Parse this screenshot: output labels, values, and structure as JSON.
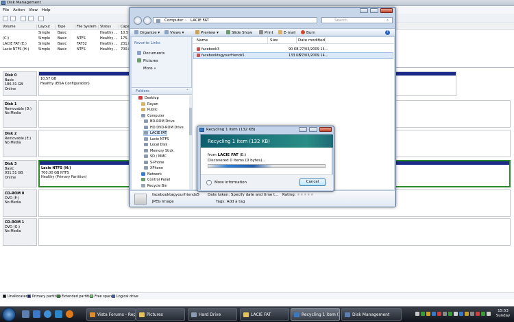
{
  "disk_mgmt": {
    "title": "Disk Management",
    "menu": [
      "File",
      "Action",
      "View",
      "Help"
    ],
    "columns": [
      "Volume",
      "Layout",
      "Type",
      "File System",
      "Status",
      "Capa"
    ],
    "volumes": [
      {
        "name": "",
        "layout": "Simple",
        "type": "Basic",
        "fs": "",
        "status": "Healthy ...",
        "cap": "10.5"
      },
      {
        "name": "(C:)",
        "layout": "Simple",
        "type": "Basic",
        "fs": "NTFS",
        "status": "Healthy ...",
        "cap": "175."
      },
      {
        "name": "LACIE FAT (E:)",
        "layout": "Simple",
        "type": "Basic",
        "fs": "FAT32",
        "status": "Healthy ...",
        "cap": "231.8"
      },
      {
        "name": "Lacie NTFS (H:)",
        "layout": "Simple",
        "type": "Basic",
        "fs": "NTFS",
        "status": "Healthy ...",
        "cap": "700.8"
      }
    ],
    "disks": [
      {
        "name": "Disk 0",
        "l1": "Basic",
        "l2": "186.31 GB",
        "l3": "Online",
        "p1": "",
        "p2": "10.57 GB",
        "p3": "Healthy (EISA Configuration)"
      },
      {
        "name": "Disk 1",
        "l1": "Removable (D:)",
        "l2": "",
        "l3": "No Media",
        "p1": "",
        "p2": "",
        "p3": ""
      },
      {
        "name": "Disk 2",
        "l1": "Removable (E:)",
        "l2": "",
        "l3": "No Media",
        "p1": "",
        "p2": "",
        "p3": ""
      },
      {
        "name": "Disk 3",
        "l1": "Basic",
        "l2": "931.51 GB",
        "l3": "Online",
        "p1": "Lacie NTFS  (H:)",
        "p2": "700.00 GB NTFS",
        "p3": "Healthy (Primary Partition)"
      },
      {
        "name": "CD-ROM 0",
        "l1": "DVD (F:)",
        "l2": "",
        "l3": "No Media",
        "p1": "",
        "p2": "",
        "p3": ""
      },
      {
        "name": "CD-ROM 1",
        "l1": "DVD (G:)",
        "l2": "",
        "l3": "No Media",
        "p1": "",
        "p2": "",
        "p3": ""
      }
    ],
    "legend": [
      {
        "label": "Unallocated",
        "color": "#000000"
      },
      {
        "label": "Primary partition",
        "color": "#1a2a86"
      },
      {
        "label": "Extended partition",
        "color": "#2c8a2c"
      },
      {
        "label": "Free space",
        "color": "#6ad06a"
      },
      {
        "label": "Logical drive",
        "color": "#3a58c8"
      }
    ]
  },
  "explorer": {
    "breadcrumb": [
      "Computer",
      "LACIE FAT"
    ],
    "search_placeholder": "Search",
    "commands": [
      "Organize",
      "Views",
      "Slide Show",
      "Print",
      "E-mail",
      "Burn"
    ],
    "favorites_head": "Favorite Links",
    "favorites": [
      "Documents",
      "Pictures"
    ],
    "more": "More",
    "folders_head": "Folders",
    "tree": [
      {
        "label": "Desktop",
        "indent": 0
      },
      {
        "label": "Rayan",
        "indent": 1
      },
      {
        "label": "Public",
        "indent": 1
      },
      {
        "label": "Computer",
        "indent": 1
      },
      {
        "label": "BD-ROM Drive",
        "indent": 2
      },
      {
        "label": "HD DVD-ROM Drive",
        "indent": 2
      },
      {
        "label": "LACIE FAT",
        "indent": 2
      },
      {
        "label": "Lacie NTFS",
        "indent": 2
      },
      {
        "label": "Local Disk",
        "indent": 2
      },
      {
        "label": "Memory Stick",
        "indent": 2
      },
      {
        "label": "SD / MMC",
        "indent": 2
      },
      {
        "label": "S-Phone",
        "indent": 2
      },
      {
        "label": "XPhone",
        "indent": 2
      },
      {
        "label": "Network",
        "indent": 1
      },
      {
        "label": "Control Panel",
        "indent": 1
      },
      {
        "label": "Recycle Bin",
        "indent": 1
      }
    ],
    "file_columns": [
      "Name",
      "Size",
      "Date modified"
    ],
    "files": [
      {
        "name": "facebook3",
        "size": "90 KB",
        "date": "27/03/2009 14..."
      },
      {
        "name": "facebooktagyourfriends5",
        "size": "133 KB",
        "date": "27/03/2009 14..."
      }
    ],
    "details": {
      "filename": "facebooktagyourfriends5",
      "filetype": "JPEG Image",
      "date_taken": "Date taken: Specify date and time t...",
      "tags": "Tags:  Add a tag",
      "rating": "Rating:"
    }
  },
  "recycle_dialog": {
    "title": "Recycling 1 item (132 KB)",
    "heading": "Recycling 1 item (132 KB)",
    "from_label": "from",
    "from_drive": "LACIE FAT",
    "from_letter": "(E:)",
    "discovered": "Discovered 0 items (0 bytes)...",
    "progress": 0.55,
    "more_info": "More information",
    "cancel": "Cancel"
  },
  "taskbar": {
    "tasks": [
      {
        "label": "Vista Forums - Repl...",
        "active": false,
        "icon": "#e08a2a"
      },
      {
        "label": "Pictures",
        "active": false,
        "icon": "#e6c25a"
      },
      {
        "label": "Hard Drive",
        "active": false,
        "icon": "#8a9ab0"
      },
      {
        "label": "LACIE FAT",
        "active": false,
        "icon": "#e6c25a"
      },
      {
        "label": "Recycling 1 item (1...",
        "active": true,
        "icon": "#3b78c0"
      },
      {
        "label": "Disk Management",
        "active": false,
        "icon": "#5a7fb0"
      }
    ],
    "time": "15:53",
    "day": "Sunday"
  },
  "colors": {
    "accent": "#1a2a86",
    "banner": "#2a8d86"
  }
}
